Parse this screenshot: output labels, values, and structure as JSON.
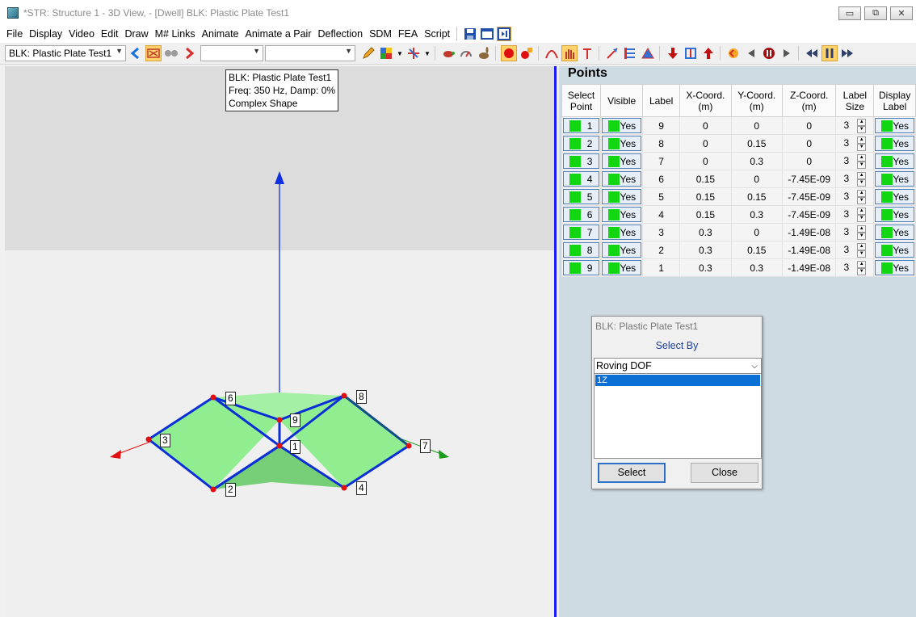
{
  "window": {
    "title": "*STR: Structure 1 - 3D View,  - [Dwell] BLK: Plastic Plate Test1",
    "controls": [
      "▭",
      "⧉",
      "✕"
    ]
  },
  "menu": [
    "File",
    "Display",
    "Video",
    "Edit",
    "Draw",
    "M# Links",
    "Animate",
    "Animate a Pair",
    "Deflection",
    "SDM",
    "FEA",
    "Script"
  ],
  "toolbar": {
    "block_select": "BLK: Plastic Plate Test1",
    "combo2": "",
    "combo3": ""
  },
  "view": {
    "tooltip": {
      "line1": "BLK: Plastic Plate Test1",
      "line2": "Freq: 350 Hz, Damp: 0%",
      "line3": "Complex Shape"
    }
  },
  "points_panel": {
    "title": "Points",
    "columns": [
      [
        "Select",
        "Point"
      ],
      [
        "Visible",
        ""
      ],
      [
        "Label",
        ""
      ],
      [
        "X-Coord.",
        "(m)"
      ],
      [
        "Y-Coord.",
        "(m)"
      ],
      [
        "Z-Coord.",
        "(m)"
      ],
      [
        "Label",
        "Size"
      ],
      [
        "Display",
        "Label"
      ]
    ],
    "rows": [
      {
        "point": "1",
        "visible": "Yes",
        "label": "9",
        "x": "0",
        "y": "0",
        "z": "0",
        "size": "3",
        "display": "Yes"
      },
      {
        "point": "2",
        "visible": "Yes",
        "label": "8",
        "x": "0",
        "y": "0.15",
        "z": "0",
        "size": "3",
        "display": "Yes"
      },
      {
        "point": "3",
        "visible": "Yes",
        "label": "7",
        "x": "0",
        "y": "0.3",
        "z": "0",
        "size": "3",
        "display": "Yes"
      },
      {
        "point": "4",
        "visible": "Yes",
        "label": "6",
        "x": "0.15",
        "y": "0",
        "z": "-7.45E-09",
        "size": "3",
        "display": "Yes"
      },
      {
        "point": "5",
        "visible": "Yes",
        "label": "5",
        "x": "0.15",
        "y": "0.15",
        "z": "-7.45E-09",
        "size": "3",
        "display": "Yes"
      },
      {
        "point": "6",
        "visible": "Yes",
        "label": "4",
        "x": "0.15",
        "y": "0.3",
        "z": "-7.45E-09",
        "size": "3",
        "display": "Yes"
      },
      {
        "point": "7",
        "visible": "Yes",
        "label": "3",
        "x": "0.3",
        "y": "0",
        "z": "-1.49E-08",
        "size": "3",
        "display": "Yes"
      },
      {
        "point": "8",
        "visible": "Yes",
        "label": "2",
        "x": "0.3",
        "y": "0.15",
        "z": "-1.49E-08",
        "size": "3",
        "display": "Yes"
      },
      {
        "point": "9",
        "visible": "Yes",
        "label": "1",
        "x": "0.3",
        "y": "0.3",
        "z": "-1.49E-08",
        "size": "3",
        "display": "Yes"
      }
    ]
  },
  "dialog": {
    "title": "BLK: Plastic Plate Test1",
    "label": "Select By",
    "combo_value": "Roving DOF",
    "list_items": [
      "1Z"
    ],
    "select_button": "Select",
    "close_button": "Close"
  },
  "model_labels": [
    "1",
    "2",
    "3",
    "4",
    "6",
    "7",
    "8",
    "9"
  ],
  "colors": {
    "accent": "#1a1aff",
    "mesh_edge": "#0b2fd6",
    "mesh_fill": "#90ee90",
    "point": "#e01010",
    "status_green": "#12d612"
  }
}
